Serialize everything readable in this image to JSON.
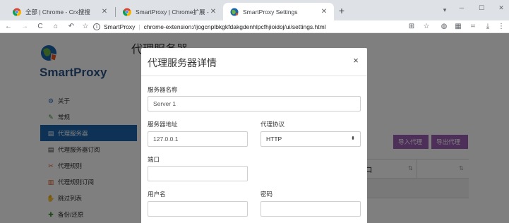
{
  "browser": {
    "tabs": [
      {
        "title": "全部 | Chrome - Crx搜搜",
        "active": false
      },
      {
        "title": "SmartProxy | Chrome扩展 - Crx",
        "active": false
      },
      {
        "title": "SmartProxy Settings",
        "active": true
      }
    ],
    "new_tab_icon": "+",
    "tab_search_icon": "▾",
    "window_controls": {
      "minimize": "─",
      "maximize": "☐",
      "close": "✕"
    },
    "toolbar": {
      "back": "←",
      "forward": "→",
      "reload": "C",
      "home": "⌂",
      "undo": "↶",
      "bookmark": "☆",
      "site_info_icon": "i",
      "site_name": "SmartProxy",
      "separator": "|",
      "url": "chrome-extension://jogcnplbkgkfdakgdenhlpcfhjioidoj/ui/settings.html",
      "right_icons": [
        "⊞",
        "☆",
        "◍",
        "▦",
        "⌗",
        "⤓",
        "⋮"
      ]
    }
  },
  "page": {
    "brand": "SmartProxy",
    "heading": "代理服务器",
    "nav": [
      {
        "label": "关于",
        "icon": "⚙",
        "icon_name": "gear-icon",
        "active": false,
        "icon_color": "#1a64ad"
      },
      {
        "label": "常规",
        "icon": "🔧",
        "icon_name": "wrench-icon",
        "active": false,
        "icon_color": "#3a8a2a"
      },
      {
        "label": "代理服务器",
        "icon": "▤",
        "icon_name": "server-icon",
        "active": true,
        "icon_color": "#ffffff"
      },
      {
        "label": "代理服务器订阅",
        "icon": "▤",
        "icon_name": "list-icon",
        "active": false,
        "icon_color": "#333333"
      },
      {
        "label": "代理规则",
        "icon": "✂",
        "icon_name": "rules-icon",
        "active": false,
        "icon_color": "#d9541c"
      },
      {
        "label": "代理规则订阅",
        "icon": "▥",
        "icon_name": "book-icon",
        "active": false,
        "icon_color": "#d9541c"
      },
      {
        "label": "跳过列表",
        "icon": "✋",
        "icon_name": "hand-icon",
        "active": false,
        "icon_color": "#333333"
      },
      {
        "label": "备份/还原",
        "icon": "✚",
        "icon_name": "backup-icon",
        "active": false,
        "icon_color": "#3a8a2a"
      }
    ],
    "buttons": {
      "import": "导入代理",
      "export": "导出代理"
    },
    "table": {
      "partial_header": "口",
      "sort_icon": "⇅"
    },
    "accent_color": "#1a64ad",
    "button_color": "#9c5fb5"
  },
  "modal": {
    "title": "代理服务器详情",
    "close_icon": "×",
    "fields": {
      "name_label": "服务器名称",
      "name_value": "Server 1",
      "address_label": "服务器地址",
      "address_value": "127.0.0.1",
      "protocol_label": "代理协议",
      "protocol_value": "HTTP",
      "protocol_caret": "▲▼",
      "port_label": "端口",
      "port_value": "",
      "username_label": "用户名",
      "username_value": "",
      "password_label": "密码",
      "password_value": ""
    }
  }
}
